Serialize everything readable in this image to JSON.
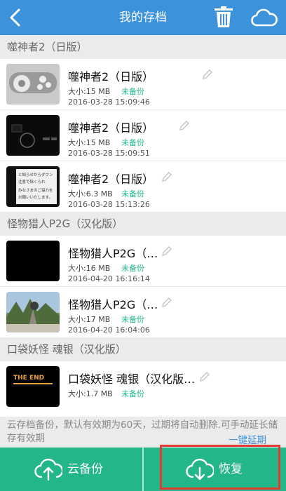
{
  "header": {
    "title": "我的存档",
    "icons": [
      "back-arrow-icon",
      "trash-icon",
      "cloud-icon"
    ]
  },
  "groups": [
    {
      "title": "噬神者2（日版）",
      "items": [
        {
          "name": "噬神者2（日版）",
          "size": "大小:15 MB",
          "status": "未备份",
          "date": "2016-03-28 15:09:46"
        },
        {
          "name": "噬神者2（日版）",
          "size": "大小:15 MB",
          "status": "未备份",
          "date": "2016-03-28 15:09:51"
        },
        {
          "name": "噬神者2（日版）",
          "size": "大小:6.3 MB",
          "status": "未备份",
          "date": "2016-03-28 15:13:26"
        }
      ]
    },
    {
      "title": "怪物猎人P2G（汉化版）",
      "items": [
        {
          "name": "怪物猎人P2G（…",
          "size": "大小:16 MB",
          "status": "未备份",
          "date": "2016-04-20 16:16:14"
        },
        {
          "name": "怪物猎人P2G（…",
          "size": "大小:17 MB",
          "status": "未备份",
          "date": "2016-04-20 16:04:06"
        }
      ]
    },
    {
      "title": "口袋妖怪 魂银（汉化版）",
      "items": [
        {
          "name": "口袋妖怪 魂银（汉化版…",
          "size": "大小:1.7 MB",
          "status": "未备份"
        }
      ]
    }
  ],
  "thumb_texts": {
    "jp_lines": [
      "と知らせからダウン",
      "注意で除くられ",
      "みなさまのご協力を",
      "お願いいたします。"
    ],
    "end_logo": "THE END"
  },
  "notice": {
    "text": "云存档备份，默认有效期为60天，过期将自动删除.可手动延长储存有效期",
    "link": "一键延期"
  },
  "bottom": {
    "backup_label": "云备份",
    "restore_label": "恢复"
  },
  "colors": {
    "topbar": "#3d92dc",
    "bottombar": "#22b689",
    "status_green": "#23b98e",
    "link_blue": "#3d92dc",
    "highlight_red": "#e53935"
  }
}
